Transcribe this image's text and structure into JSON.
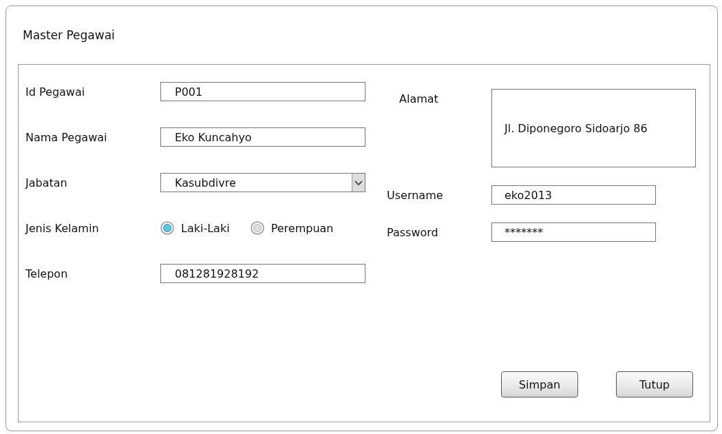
{
  "window": {
    "title": "Master Pegawai"
  },
  "left_fields": [
    {
      "kind": "text",
      "label": "Id Pegawai",
      "value": "P001"
    },
    {
      "kind": "text",
      "label": "Nama Pegawai",
      "value": "Eko Kuncahyo"
    },
    {
      "kind": "select",
      "label": "Jabatan",
      "value": "Kasubdivre"
    },
    {
      "kind": "radio",
      "label": "Jenis Kelamin",
      "options": [
        {
          "label": "Laki-Laki",
          "selected": true
        },
        {
          "label": "Perempuan",
          "selected": false
        }
      ]
    },
    {
      "kind": "text",
      "label": "Telepon",
      "value": "081281928192"
    }
  ],
  "right_fields": [
    {
      "kind": "textarea",
      "label": "Alamat",
      "value": "Jl. Diponegoro Sidoarjo 86"
    },
    {
      "kind": "text",
      "label": "Username",
      "value": "eko2013"
    },
    {
      "kind": "text",
      "label": "Password",
      "value": "*******"
    }
  ],
  "buttons": [
    "Simpan",
    "Tutup"
  ]
}
